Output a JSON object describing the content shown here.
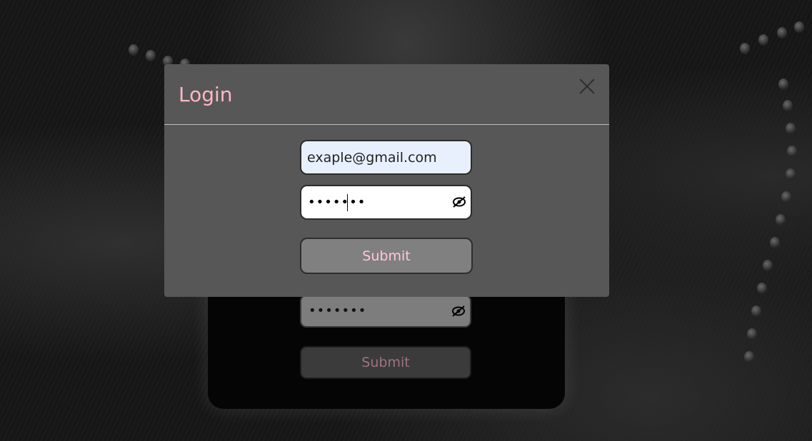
{
  "modal": {
    "title": "Login",
    "email": {
      "value": "exaple@gmail.com"
    },
    "password": {
      "masked_value": "•••••••"
    },
    "submit_label": "Submit",
    "close_icon": "close-icon",
    "eye_icon": "eye-slash-icon"
  },
  "background_form": {
    "password": {
      "masked_value": "•••••••"
    },
    "submit_label": "Submit"
  },
  "colors": {
    "title": "#ffb7c5",
    "modal_bg": "#575757",
    "submit_bg": "#808080",
    "submit_text": "#ffc8d5",
    "email_autofill_bg": "#e8f0fe"
  }
}
